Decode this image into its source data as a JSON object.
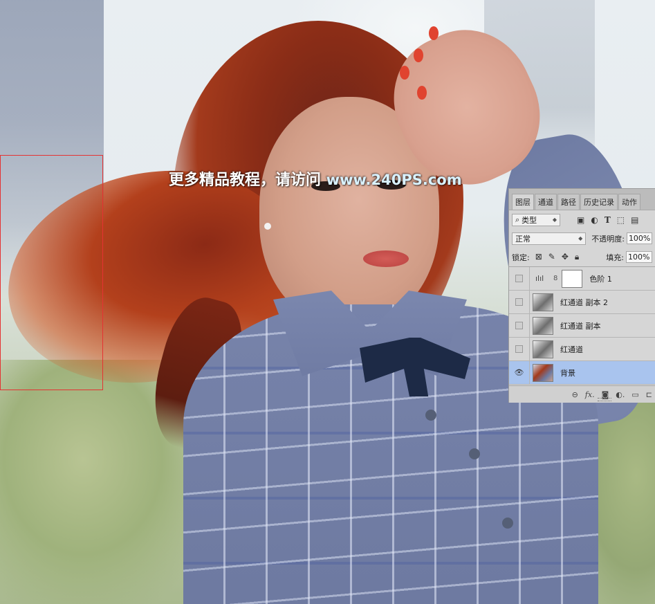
{
  "watermark": {
    "text": "更多精品教程，请访问 ",
    "url": "www.240PS.com"
  },
  "layers_panel": {
    "tabs": [
      {
        "label": "图层",
        "active": true
      },
      {
        "label": "通道",
        "active": false
      },
      {
        "label": "路径",
        "active": false
      },
      {
        "label": "历史记录",
        "active": false
      },
      {
        "label": "动作",
        "active": false
      }
    ],
    "filter": {
      "search_glyph": "⌕",
      "kind_label": "类型",
      "icons": [
        "image-filter-icon",
        "adjustment-filter-icon",
        "type-filter-icon",
        "shape-filter-icon",
        "smart-object-filter-icon"
      ]
    },
    "blend_mode": "正常",
    "opacity_label": "不透明度:",
    "opacity_value": "100%",
    "lock_label": "锁定:",
    "fill_label": "填充:",
    "fill_value": "100%",
    "layers": [
      {
        "name": "色阶 1",
        "type": "adjustment",
        "visible": false,
        "selected": false
      },
      {
        "name": "红通道 副本 2",
        "type": "gray",
        "visible": false,
        "selected": false
      },
      {
        "name": "红通道 副本",
        "type": "gray",
        "visible": false,
        "selected": false
      },
      {
        "name": "红通道",
        "type": "gray",
        "visible": false,
        "selected": false
      },
      {
        "name": "背景",
        "type": "color",
        "visible": true,
        "selected": true
      }
    ],
    "footer_icons": [
      "link-layers-icon",
      "fx-icon",
      "add-mask-icon",
      "new-adjustment-icon",
      "new-group-icon",
      "new-layer-icon"
    ]
  },
  "colors": {
    "selection_outline": "#e53232",
    "selected_layer": "#a9c4ee",
    "panel_bg": "#d6d6d6"
  }
}
